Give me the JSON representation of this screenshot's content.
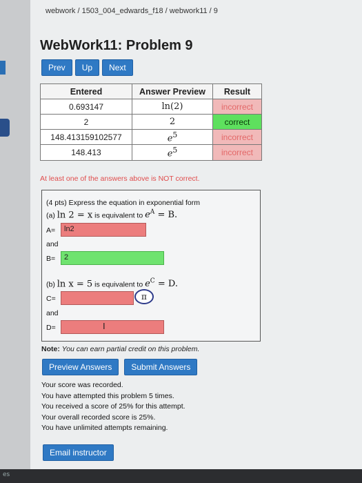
{
  "breadcrumb": "webwork / 1503_004_edwards_f18 / webwork11 / 9",
  "page_title": "WebWork11: Problem 9",
  "nav": {
    "prev": "Prev",
    "up": "Up",
    "next": "Next"
  },
  "results": {
    "headers": [
      "Entered",
      "Answer Preview",
      "Result"
    ],
    "rows": [
      {
        "entered": "0.693147",
        "preview": "ln(2)",
        "result": "incorrect"
      },
      {
        "entered": "2",
        "preview": "2",
        "result": "correct"
      },
      {
        "entered": "148.413159102577",
        "preview": "e",
        "preview_sup": "5",
        "result": "incorrect"
      },
      {
        "entered": "148.413",
        "preview": "e",
        "preview_sup": "5",
        "result": "incorrect"
      }
    ]
  },
  "warning": "At least one of the answers above is NOT correct.",
  "problem": {
    "intro": "(4 pts) Express the equation in exponential form",
    "part_a_label": "(a)",
    "part_a_math": "ln 2 = x",
    "part_a_mid": "is equivalent to",
    "part_a_rhs_base": "e",
    "part_a_rhs_sup": "A",
    "part_a_rhs_tail": "= B.",
    "a_label": "A=",
    "a_value": "ln2",
    "and1": "and",
    "b_label": "B=",
    "b_value": "2",
    "part_b_label": "(b)",
    "part_b_math": "ln x = 5",
    "part_b_mid": "is equivalent to",
    "part_b_rhs_base": "e",
    "part_b_rhs_sup": "C",
    "part_b_rhs_tail": "= D.",
    "c_label": "C=",
    "c_value": "",
    "pi_symbol": "π",
    "and2": "and",
    "d_label": "D=",
    "d_value": ""
  },
  "note_label": "Note:",
  "note_text": "You can earn partial credit on this problem.",
  "actions": {
    "preview": "Preview Answers",
    "submit": "Submit Answers"
  },
  "status_lines": [
    "Your score was recorded.",
    "You have attempted this problem 5 times.",
    "You received a score of 25% for this attempt.",
    "Your overall recorded score is 25%.",
    "You have unlimited attempts remaining."
  ],
  "email_button": "Email instructor",
  "taskbar_text": "es",
  "colors": {
    "accent": "#2f79c4",
    "incorrect_bg": "#f1b9b9",
    "correct_bg": "#5ee05e",
    "warning": "#e04c4c"
  }
}
